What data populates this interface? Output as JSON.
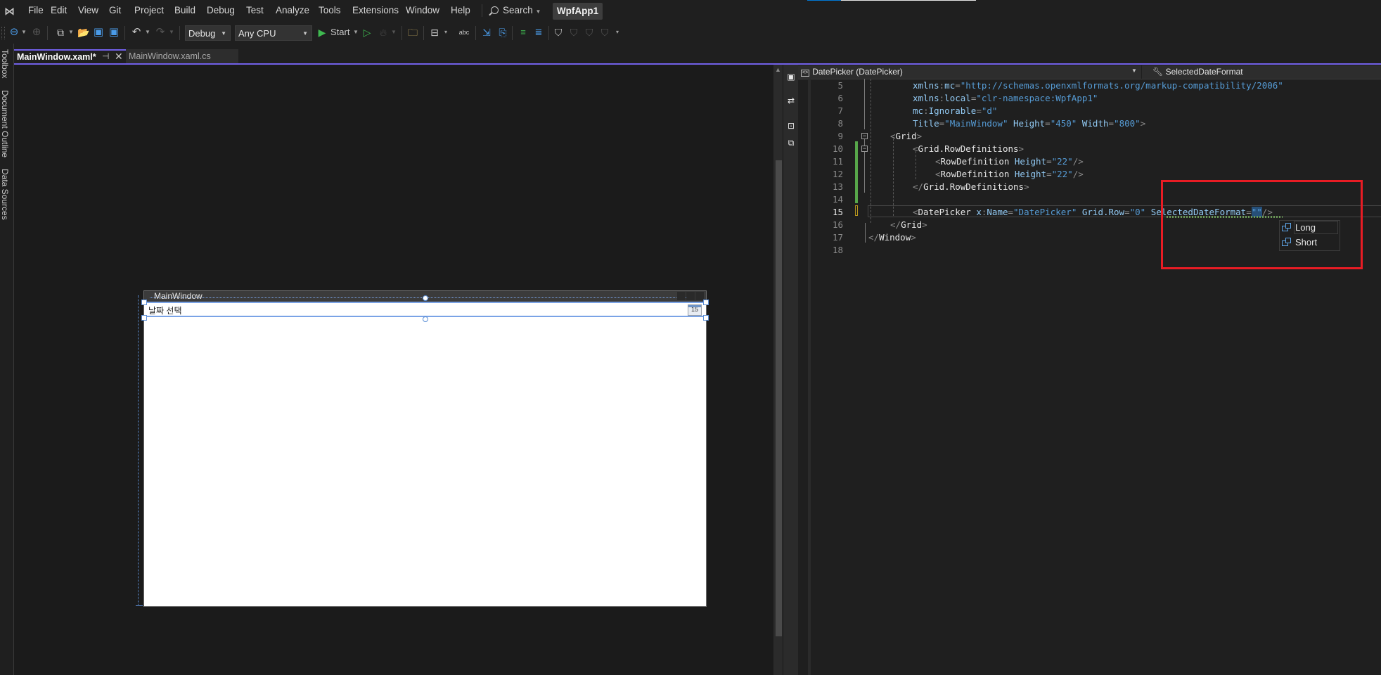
{
  "menubar": {
    "items": [
      "File",
      "Edit",
      "View",
      "Git",
      "Project",
      "Build",
      "Debug",
      "Test",
      "Analyze",
      "Tools",
      "Extensions",
      "Window",
      "Help"
    ],
    "search_label": "Search",
    "project_name": "WpfApp1"
  },
  "toolbar": {
    "configuration": "Debug",
    "platform": "Any CPU",
    "start_label": "Start"
  },
  "tabs": [
    {
      "label": "MainWindow.xaml*",
      "active": true
    },
    {
      "label": "MainWindow.xaml.cs",
      "active": false
    }
  ],
  "side_panels": [
    "Toolbox",
    "Document Outline",
    "Data Sources"
  ],
  "designer": {
    "window_title": "MainWindow",
    "datepicker_placeholder": "날짜 선택",
    "calendar_day": "15"
  },
  "editor": {
    "nav_left": "DatePicker (DatePicker)",
    "nav_right": "SelectedDateFormat",
    "current_line": 15,
    "line_numbers": [
      "5",
      "6",
      "7",
      "8",
      "9",
      "10",
      "11",
      "12",
      "13",
      "14",
      "15",
      "16",
      "17",
      "18"
    ],
    "lines": {
      "l5": {
        "attr_ns": "xmlns",
        "colon": ":",
        "attr": "mc",
        "eq": "=",
        "value": "\"http://schemas.openxmlformats.org/markup-compatibility/2006\""
      },
      "l6": {
        "attr_ns": "xmlns",
        "colon": ":",
        "attr": "local",
        "eq": "=",
        "value": "\"clr-namespace:WpfApp1\""
      },
      "l7": {
        "attr_ns": "mc",
        "colon": ":",
        "attr": "Ignorable",
        "eq": "=",
        "value": "\"d\""
      },
      "l8": {
        "a1": "Title",
        "v1": "\"MainWindow\"",
        "a2": "Height",
        "v2": "\"450\"",
        "a3": "Width",
        "v3": "\"800\"",
        "close": ">"
      },
      "l9": {
        "open": "<",
        "tag": "Grid",
        "close": ">"
      },
      "l10": {
        "open": "<",
        "tag": "Grid.RowDefinitions",
        "close": ">"
      },
      "l11": {
        "open": "<",
        "tag": "RowDefinition",
        "attr": "Height",
        "eq": "=",
        "value": "\"22\"",
        "close": "/>"
      },
      "l12": {
        "open": "<",
        "tag": "RowDefinition",
        "attr": "Height",
        "eq": "=",
        "value": "\"22\"",
        "close": "/>"
      },
      "l13": {
        "open": "</",
        "tag": "Grid.RowDefinitions",
        "close": ">"
      },
      "l15": {
        "open": "<",
        "tag": "DatePicker",
        "a1_ns": "x",
        "a1": "Name",
        "v1": "\"DatePicker\"",
        "a2": "Grid.Row",
        "v2": "\"0\"",
        "a3": "SelectedDateFormat",
        "v3": "\"\"",
        "close": "/>"
      },
      "l16": {
        "open": "</",
        "tag": "Grid",
        "close": ">"
      },
      "l17": {
        "open": "</",
        "tag": "Window",
        "close": ">"
      }
    },
    "completion": {
      "items": [
        {
          "label": "Long",
          "selected": true
        },
        {
          "label": "Short",
          "selected": false
        }
      ]
    },
    "highlight_color": "#e81c24"
  }
}
